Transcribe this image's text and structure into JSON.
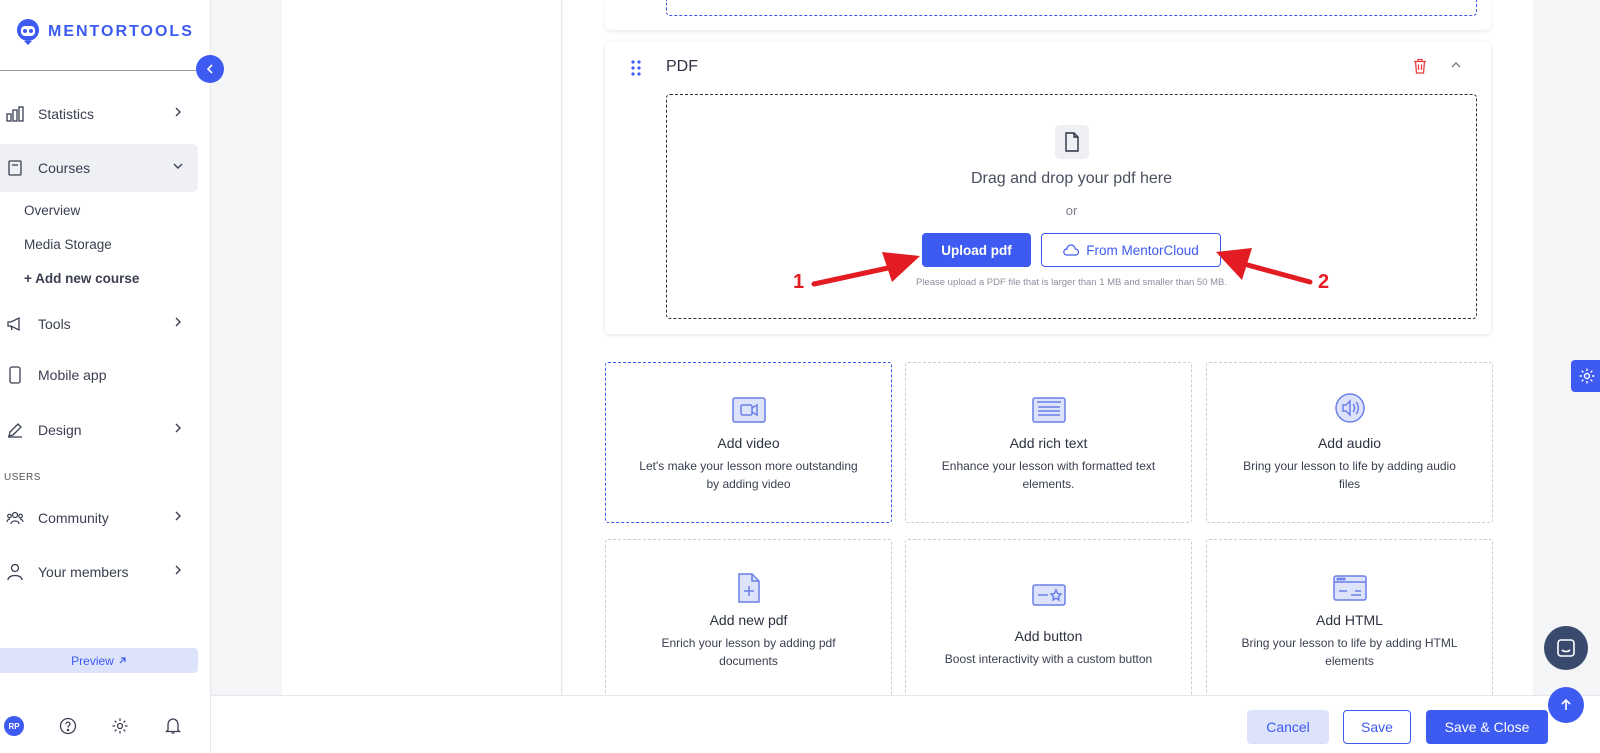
{
  "brand": {
    "name": "MENTORTOOLS",
    "accent": "#3d5af1"
  },
  "sidebar": {
    "items": [
      {
        "label": "Statistics",
        "icon": "bar-chart-icon"
      },
      {
        "label": "Courses",
        "icon": "book-icon"
      },
      {
        "label": "Tools",
        "icon": "megaphone-icon"
      },
      {
        "label": "Mobile app",
        "icon": "phone-icon"
      },
      {
        "label": "Design",
        "icon": "pencil-icon"
      },
      {
        "label": "Community",
        "icon": "group-icon"
      },
      {
        "label": "Your members",
        "icon": "user-icon"
      }
    ],
    "sub_items": [
      "Overview",
      "Media Storage",
      "+ Add new course"
    ],
    "section_users": "USERS",
    "preview": "Preview",
    "avatar_initials": "RP"
  },
  "pdf_block": {
    "title": "PDF",
    "drop_text": "Drag and drop your pdf here",
    "or": "or",
    "upload_label": "Upload pdf",
    "cloud_label": "From MentorCloud",
    "hint": "Please upload a PDF file that is larger than 1 MB and smaller than 50 MB."
  },
  "annotations": {
    "arrow1": "1",
    "arrow2": "2",
    "color": "#e31b23"
  },
  "tiles": [
    {
      "title": "Add video",
      "desc": "Let's make your lesson more outstanding by adding video",
      "icon": "video-icon"
    },
    {
      "title": "Add rich text",
      "desc": "Enhance your lesson with formatted text elements.",
      "icon": "text-icon"
    },
    {
      "title": "Add audio",
      "desc": "Bring your lesson to life by adding audio files",
      "icon": "audio-icon"
    },
    {
      "title": "Add new pdf",
      "desc": "Enrich your lesson by adding pdf documents",
      "icon": "file-plus-icon"
    },
    {
      "title": "Add button",
      "desc": "Boost interactivity with a custom button",
      "icon": "button-icon"
    },
    {
      "title": "Add HTML",
      "desc": "Bring your lesson to life by adding HTML elements",
      "icon": "html-icon"
    }
  ],
  "footer": {
    "cancel": "Cancel",
    "save": "Save",
    "save_close": "Save & Close"
  }
}
